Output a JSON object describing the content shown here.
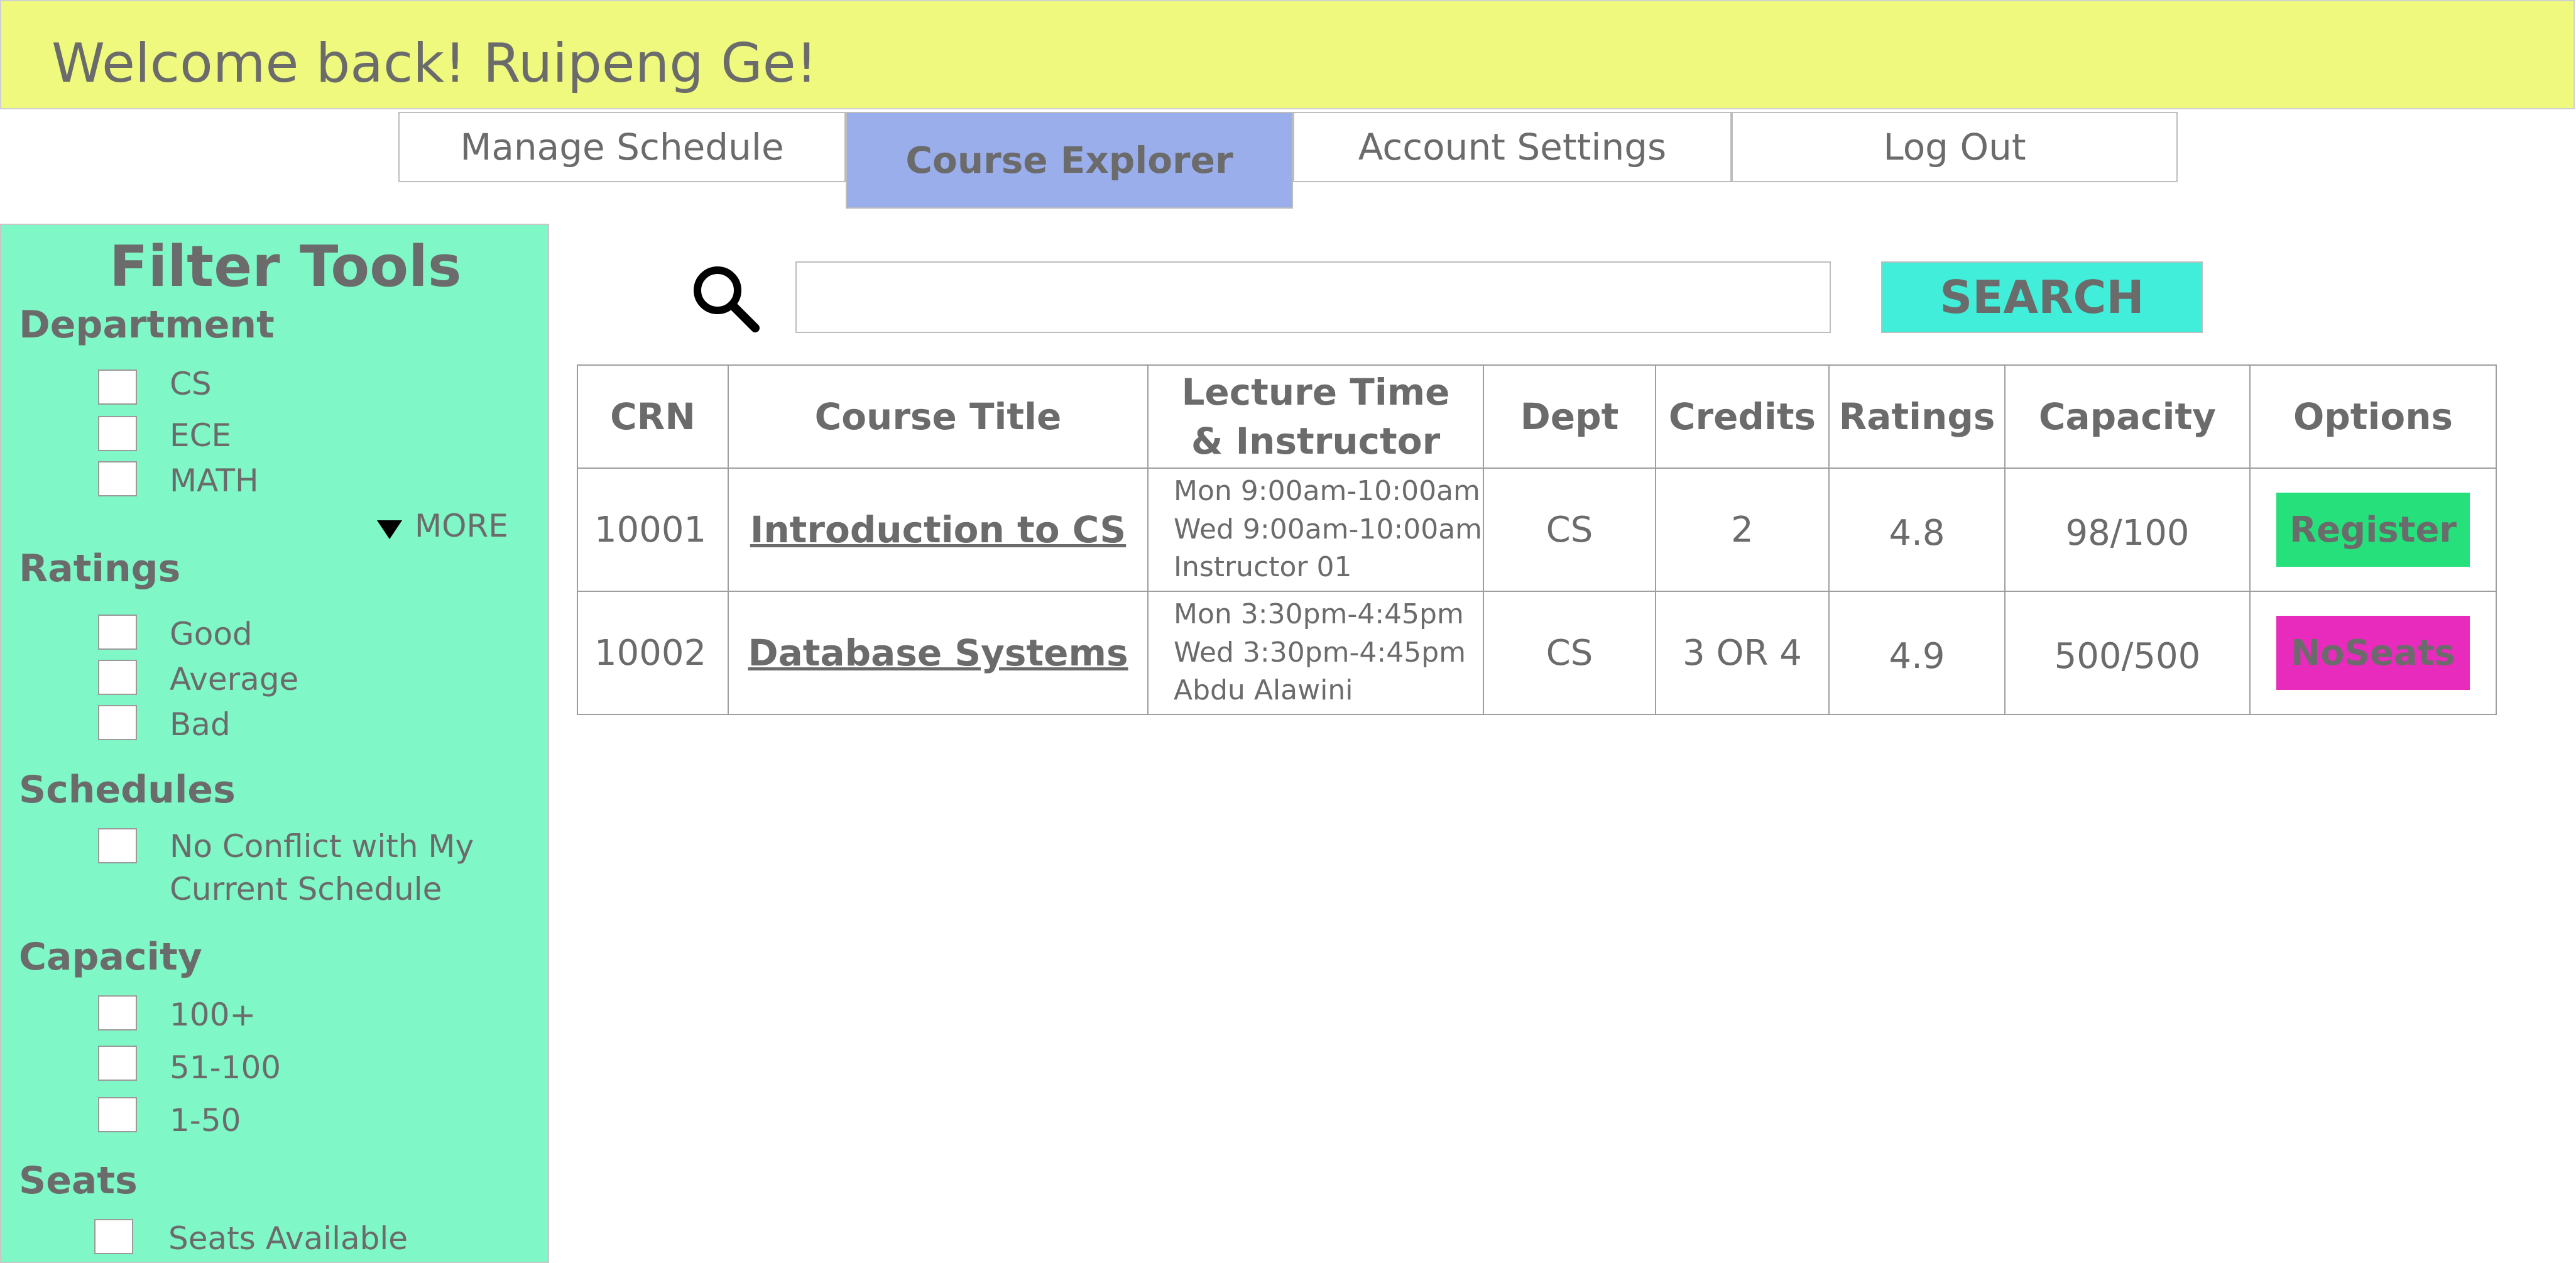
{
  "header": {
    "welcome": "Welcome back! Ruipeng Ge!"
  },
  "nav": {
    "tabs": [
      {
        "label": "Manage Schedule",
        "active": false
      },
      {
        "label": "Course Explorer",
        "active": true
      },
      {
        "label": "Account Settings",
        "active": false
      },
      {
        "label": "Log Out",
        "active": false
      }
    ]
  },
  "sidebar": {
    "title": "Filter Tools",
    "department": {
      "heading": "Department",
      "options": [
        "CS",
        "ECE",
        "MATH"
      ],
      "more_label": "MORE"
    },
    "ratings": {
      "heading": "Ratings",
      "options": [
        "Good",
        "Average",
        "Bad"
      ]
    },
    "schedules": {
      "heading": "Schedules",
      "options": [
        "No Conflict with My",
        "Current Schedule"
      ]
    },
    "capacity": {
      "heading": "Capacity",
      "options": [
        "100+",
        "51-100",
        "1-50"
      ]
    },
    "seats": {
      "heading": "Seats",
      "options": [
        "Seats Available"
      ]
    }
  },
  "search": {
    "value": "",
    "button_label": "SEARCH"
  },
  "table": {
    "headers": [
      "CRN",
      "Course Title",
      "Lecture Time",
      "& Instructor",
      "Dept",
      "Credits",
      "Ratings",
      "Capacity",
      "Options"
    ],
    "rows": [
      {
        "crn": "10001",
        "title": "Introduction to CS",
        "lecture": [
          "Mon 9:00am-10:00am",
          "Wed 9:00am-10:00am",
          "Instructor 01"
        ],
        "dept": "CS",
        "credits": "2",
        "ratings": "4.8",
        "capacity": "98/100",
        "option": "Register"
      },
      {
        "crn": "10002",
        "title": "Database Systems",
        "lecture": [
          "Mon 3:30pm-4:45pm",
          "Wed 3:30pm-4:45pm",
          "Abdu Alawini"
        ],
        "dept": "CS",
        "credits": "3 OR 4",
        "ratings": "4.9",
        "capacity": "500/500",
        "option": "NoSeats"
      }
    ]
  },
  "colors": {
    "header_bg": "#eef97e",
    "active_tab_bg": "#9aaeec",
    "sidebar_bg": "#7ff7c7",
    "search_button_bg": "#40eed9",
    "register_bg": "#25e07b",
    "noseats_bg": "#e92bbd"
  }
}
